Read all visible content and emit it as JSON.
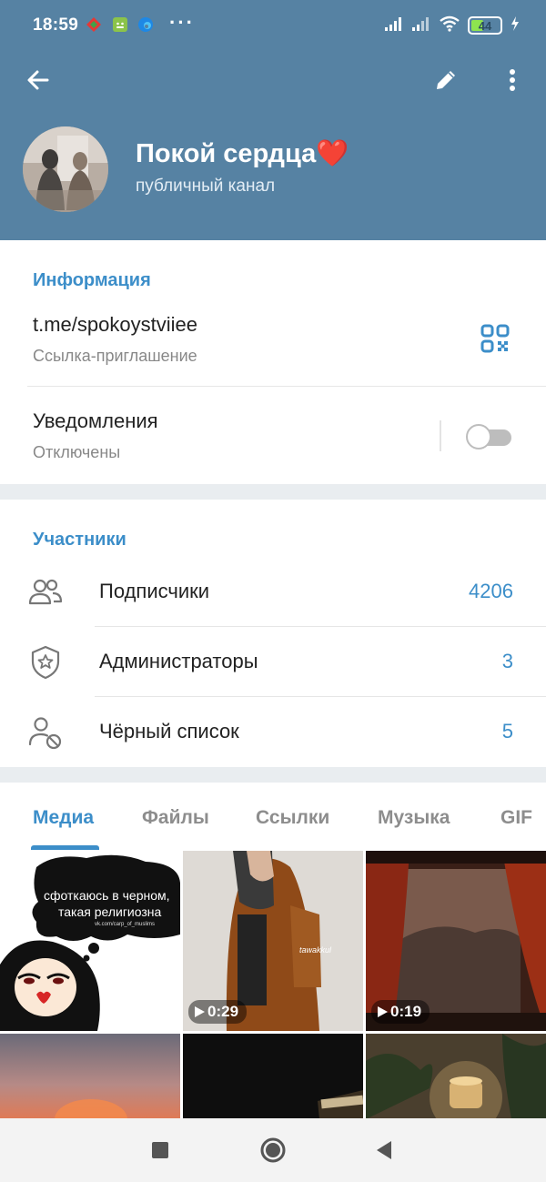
{
  "status_bar": {
    "time": "18:59",
    "dots": "···",
    "battery": "44",
    "battery_level": 0.44
  },
  "toolbar": {
    "back_icon": "arrow-left-icon",
    "edit_icon": "pencil-icon",
    "more_icon": "more-vertical-icon"
  },
  "channel": {
    "name": "Покой сердца❤️",
    "type": "публичный канал"
  },
  "info": {
    "section_title": "Информация",
    "link": "t.me/spokoystviiee",
    "link_caption": "Ссылка-приглашение",
    "notifications_label": "Уведомления",
    "notifications_status": "Отключены",
    "notifications_enabled": false
  },
  "members": {
    "section_title": "Участники",
    "rows": [
      {
        "label": "Подписчики",
        "count": "4206",
        "icon": "users-icon"
      },
      {
        "label": "Администраторы",
        "count": "3",
        "icon": "shield-star-icon"
      },
      {
        "label": "Чёрный список",
        "count": "5",
        "icon": "user-blocked-icon"
      }
    ]
  },
  "tabs": [
    {
      "label": "Медиа",
      "active": true
    },
    {
      "label": "Файлы",
      "active": false
    },
    {
      "label": "Ссылки",
      "active": false
    },
    {
      "label": "Музыка",
      "active": false
    },
    {
      "label": "GIF",
      "active": false
    }
  ],
  "media": {
    "meme_text_line1": "сфоткаюсь в черном,",
    "meme_text_line2": "такая религиозна",
    "meme_small": "vk.com/carp_of_muslims",
    "video1_duration": "0:29",
    "video2_duration": "0:19",
    "watermark": "tawakkul"
  },
  "colors": {
    "header": "#5682a3",
    "accent": "#3c8ec9"
  }
}
